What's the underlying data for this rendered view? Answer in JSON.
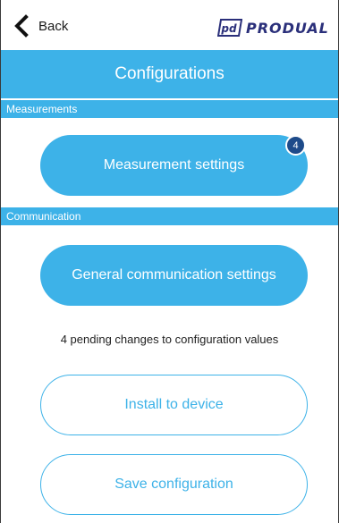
{
  "topbar": {
    "back_label": "Back",
    "back_icon": "chevron-left-icon",
    "logo_text": "PRODUAL",
    "logo_mark": "pd"
  },
  "header": {
    "title": "Configurations"
  },
  "sections": {
    "measurements": {
      "label": "Measurements",
      "button_label": "Measurement settings",
      "badge_count": "4"
    },
    "communication": {
      "label": "Communication",
      "button_label": "General communication settings"
    }
  },
  "status": {
    "pending_text": "4 pending changes to configuration values"
  },
  "actions": {
    "install_label": "Install to device",
    "save_label": "Save configuration"
  },
  "colors": {
    "accent": "#3db2e8",
    "badge": "#1e4b8a",
    "logo": "#2a2f7a"
  }
}
